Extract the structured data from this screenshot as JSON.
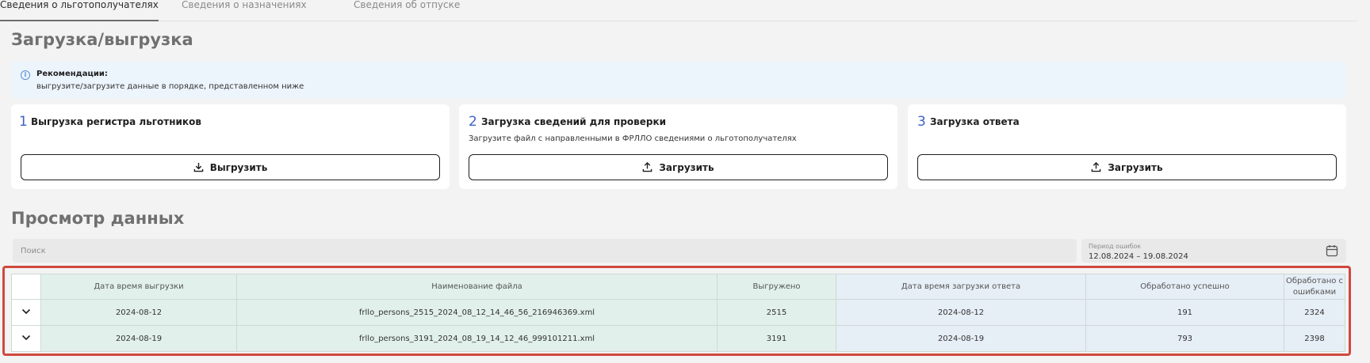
{
  "tabs": [
    {
      "label": "Сведения о льготополучателях",
      "active": true
    },
    {
      "label": "Сведения о назначениях",
      "active": false
    },
    {
      "label": "Сведения об отпуске",
      "active": false
    }
  ],
  "section_upload": {
    "title": "Загрузка/выгрузка"
  },
  "recommendation": {
    "icon": "info-icon",
    "title": "Рекомендации:",
    "text": "выгрузите/загрузите данные в порядке, представленном ниже"
  },
  "cards": [
    {
      "number": "1",
      "title": "Выгрузка регистра льготников",
      "description": "",
      "button_label": "Выгрузить",
      "button_icon": "download-icon"
    },
    {
      "number": "2",
      "title": "Загрузка сведений для проверки",
      "description": "Загрузите файл с направленными в ФРЛЛО сведениями о льготополучателях",
      "button_label": "Загрузить",
      "button_icon": "upload-icon"
    },
    {
      "number": "3",
      "title": "Загрузка ответа",
      "description": "",
      "button_label": "Загрузить",
      "button_icon": "upload-icon"
    }
  ],
  "section_view": {
    "title": "Просмотр данных"
  },
  "search": {
    "placeholder": "Поиск"
  },
  "period": {
    "label": "Период ошибок",
    "value": "12.08.2024 – 19.08.2024",
    "icon": "calendar-icon"
  },
  "table": {
    "headers": [
      "",
      "Дата время выгрузки",
      "Наименование файла",
      "Выгружено",
      "Дата время загрузки ответа",
      "Обработано успешно",
      "Обработано с ошибками"
    ],
    "rows": [
      [
        "2024-08-12",
        "frllo_persons_2515_2024_08_12_14_46_56_216946369.xml",
        "2515",
        "2024-08-12",
        "191",
        "2324"
      ],
      [
        "2024-08-19",
        "frllo_persons_3191_2024_08_19_14_12_46_999101211.xml",
        "3191",
        "2024-08-19",
        "793",
        "2398"
      ]
    ]
  },
  "colors": {
    "accent_number": "#3f5fc6",
    "highlight_border": "#d0483d",
    "green_cols": "#e1f0ea",
    "blue_cols": "#e6eef6"
  }
}
